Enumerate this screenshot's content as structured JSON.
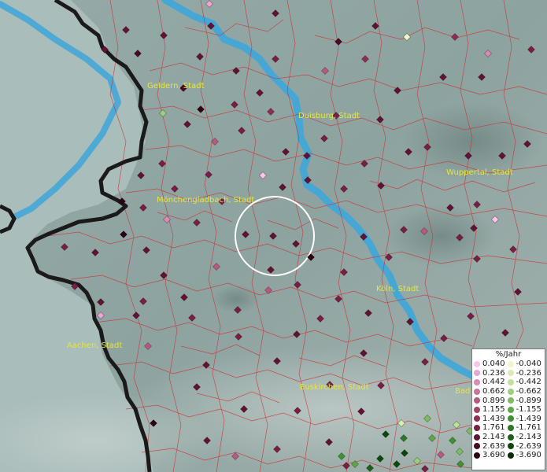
{
  "cities": [
    {
      "name": "Geldern, Stadt"
    },
    {
      "name": "Duisburg, Stadt"
    },
    {
      "name": "Wuppertal, Stadt"
    },
    {
      "name": "Mönchengladbach, Stadt"
    },
    {
      "name": "Köln, Stadt"
    },
    {
      "name": "Aachen, Stadt"
    },
    {
      "name": "Euskirchen, Stadt"
    },
    {
      "name": "Bad"
    }
  ],
  "legend": {
    "title": "%/Jahr",
    "positive": [
      {
        "value": "0.040",
        "color": "#f5c6ea"
      },
      {
        "value": "0.236",
        "color": "#eaa6d2"
      },
      {
        "value": "0.442",
        "color": "#d98bb4"
      },
      {
        "value": "0.662",
        "color": "#c9729a"
      },
      {
        "value": "0.899",
        "color": "#b55a80"
      },
      {
        "value": "1.155",
        "color": "#a04368"
      },
      {
        "value": "1.439",
        "color": "#8c2f55"
      },
      {
        "value": "1.761",
        "color": "#762044"
      },
      {
        "value": "2.143",
        "color": "#5e1434"
      },
      {
        "value": "2.639",
        "color": "#470b25"
      },
      {
        "value": "3.690",
        "color": "#2a0413"
      }
    ],
    "negative": [
      {
        "value": "-0.040",
        "color": "#f2f6c6"
      },
      {
        "value": "-0.236",
        "color": "#d9edb0"
      },
      {
        "value": "-0.442",
        "color": "#bfe29a"
      },
      {
        "value": "-0.662",
        "color": "#9fcf7e"
      },
      {
        "value": "-0.899",
        "color": "#7fbb62"
      },
      {
        "value": "-1.155",
        "color": "#5fa64a"
      },
      {
        "value": "-1.439",
        "color": "#438f36"
      },
      {
        "value": "-1.761",
        "color": "#2e7726"
      },
      {
        "value": "-2.143",
        "color": "#1d5f1a"
      },
      {
        "value": "-2.639",
        "color": "#0f4610"
      },
      {
        "value": "-3.690",
        "color": "#052a06"
      }
    ]
  }
}
